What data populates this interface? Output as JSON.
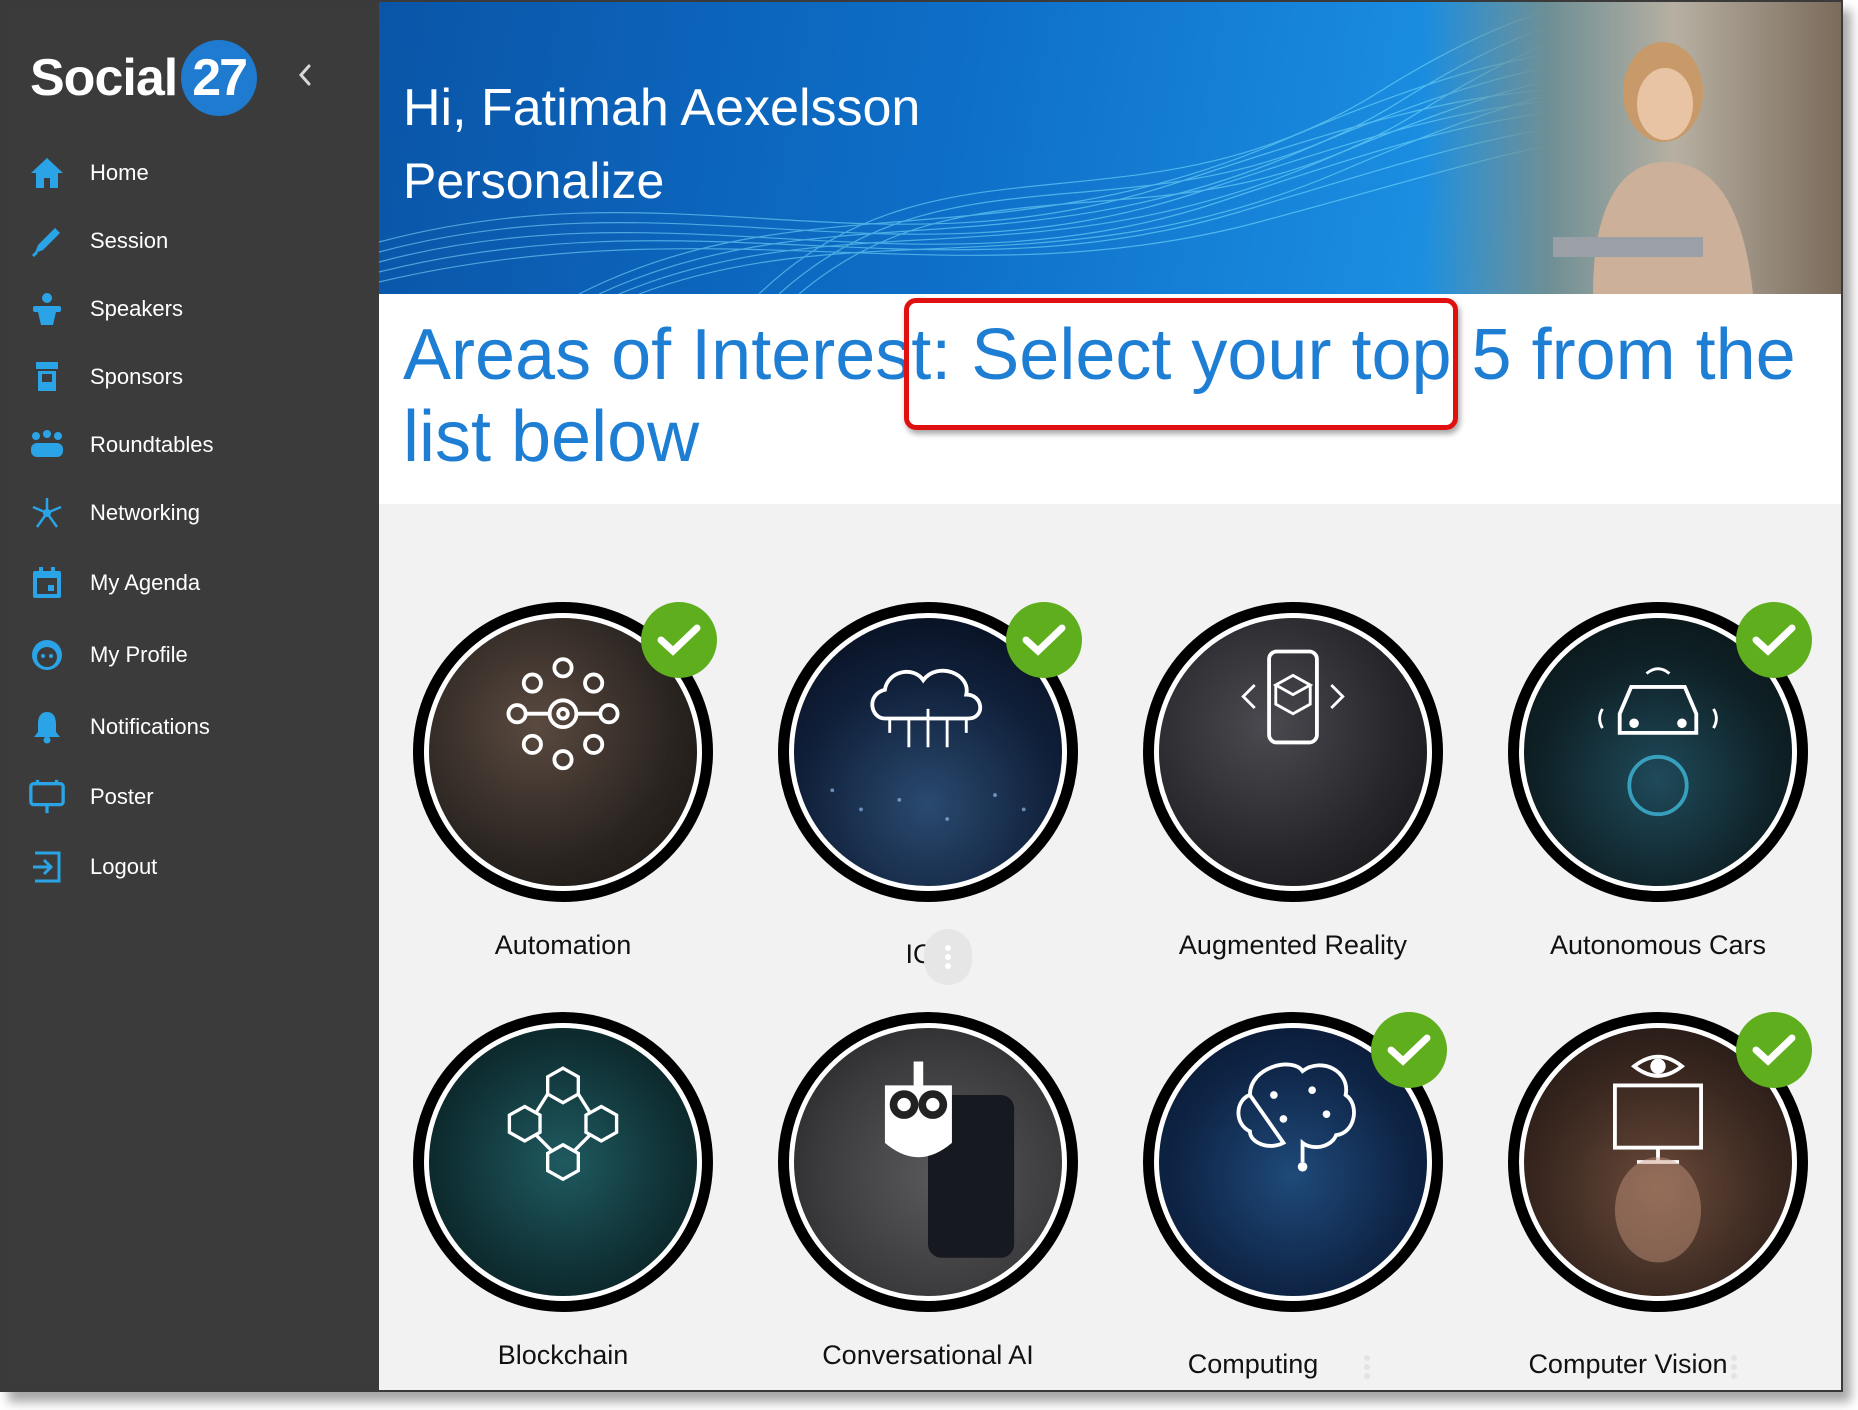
{
  "app": {
    "logo_word": "Social",
    "logo_number": "27"
  },
  "sidebar": {
    "items": [
      {
        "label": "Home",
        "icon": "home-icon"
      },
      {
        "label": "Session",
        "icon": "pen-icon"
      },
      {
        "label": "Speakers",
        "icon": "podium-icon"
      },
      {
        "label": "Sponsors",
        "icon": "booth-icon"
      },
      {
        "label": "Roundtables",
        "icon": "group-icon"
      },
      {
        "label": "Networking",
        "icon": "network-icon"
      },
      {
        "label": "My Agenda",
        "icon": "calendar-icon"
      },
      {
        "label": "My Profile",
        "icon": "face-icon"
      },
      {
        "label": "Notifications",
        "icon": "bell-icon"
      },
      {
        "label": "Poster",
        "icon": "easel-icon"
      },
      {
        "label": "Logout",
        "icon": "logout-icon"
      }
    ]
  },
  "banner": {
    "greeting": "Hi, Fatimah Aexelsson",
    "subtitle": "Personalize"
  },
  "page": {
    "heading": "Areas of Interest: Select your top 5 from the list below"
  },
  "interests": [
    {
      "name": "Automation",
      "selected": true
    },
    {
      "name": "IOT",
      "selected": true
    },
    {
      "name": "Augmented Reality",
      "selected": false
    },
    {
      "name": "Autonomous Cars",
      "selected": true
    },
    {
      "name": "Blockchain",
      "selected": false
    },
    {
      "name": "Conversational AI",
      "selected": false
    },
    {
      "name": "Computing",
      "selected": true
    },
    {
      "name": "Computer Vision",
      "selected": true
    }
  ],
  "colors": {
    "accent": "#1d7ed4",
    "sidebar_bg": "#3b3b3b",
    "icon_blue": "#2aa4e6",
    "check_green": "#5fae1e",
    "highlight_red": "#e01010"
  }
}
